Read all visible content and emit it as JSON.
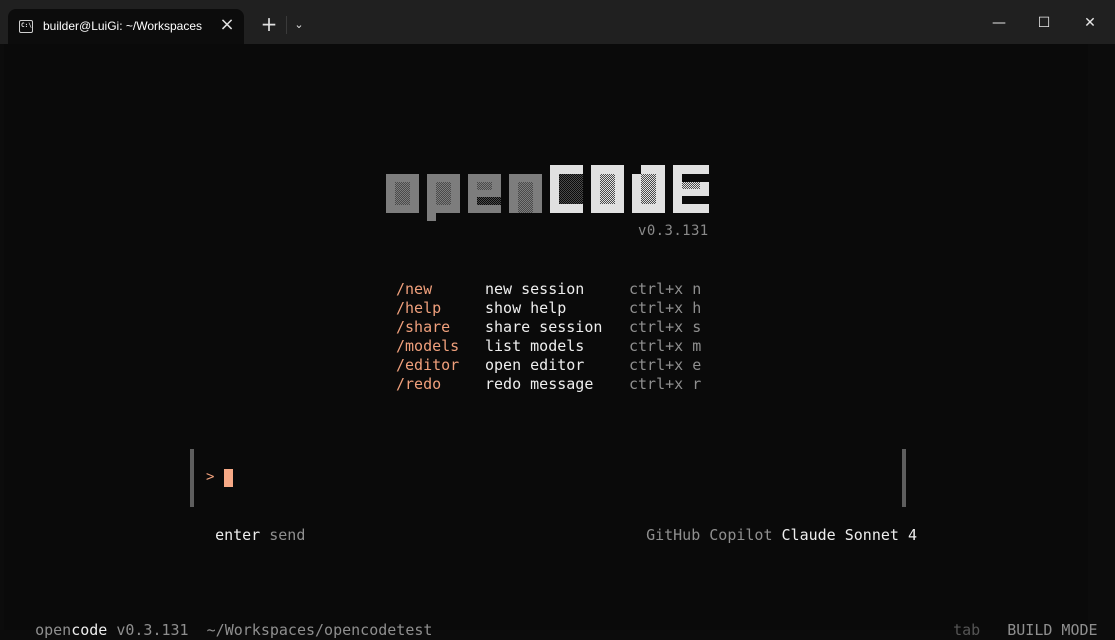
{
  "window": {
    "tab_title": "builder@LuiGi: ~/Workspaces",
    "tab_icon": "terminal-icon",
    "new_tab_label": "+",
    "controls": {
      "minimize": "—",
      "maximize": "☐",
      "close": "✕"
    }
  },
  "logo": {
    "text_left": "open",
    "text_right": "code",
    "colors": {
      "left": "#7d7d7d",
      "right": "#e0e0e0"
    }
  },
  "version": "v0.3.131",
  "commands": [
    {
      "command": "/new",
      "description": "new session",
      "shortcut": "ctrl+x n"
    },
    {
      "command": "/help",
      "description": "show help",
      "shortcut": "ctrl+x h"
    },
    {
      "command": "/share",
      "description": "share session",
      "shortcut": "ctrl+x s"
    },
    {
      "command": "/models",
      "description": "list models",
      "shortcut": "ctrl+x m"
    },
    {
      "command": "/editor",
      "description": "open editor",
      "shortcut": "ctrl+x e"
    },
    {
      "command": "/redo",
      "description": "redo message",
      "shortcut": "ctrl+x r"
    }
  ],
  "input": {
    "prompt": ">",
    "value": ""
  },
  "hints": {
    "key": "enter",
    "action": "send"
  },
  "model": {
    "provider": "GitHub Copilot",
    "name": "Claude Sonnet 4"
  },
  "statusbar": {
    "app_open": "open",
    "app_code": "code",
    "version": "v0.3.131",
    "path": "~/Workspaces/opencodetest",
    "tab_hint": "tab",
    "mode": "BUILD MODE"
  },
  "colors": {
    "accent": "#f0a07c",
    "background": "#0a0a0a",
    "muted": "#8f8f8f",
    "text": "#eeeeee"
  }
}
